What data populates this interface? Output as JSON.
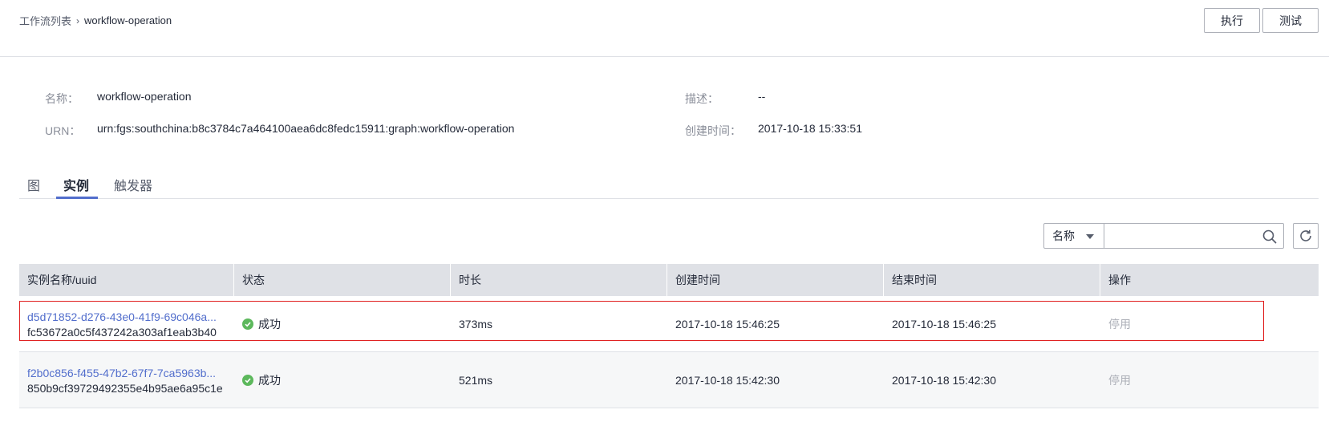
{
  "breadcrumb": {
    "parent": "工作流列表",
    "separator": "›",
    "current": "workflow-operation"
  },
  "toolbar": {
    "execute_label": "执行",
    "test_label": "测试"
  },
  "info": {
    "name_label": "名称：",
    "name_value": "workflow-operation",
    "urn_label": "URN：",
    "urn_value": "urn:fgs:southchina:b8c3784c7a464100aea6dc8fedc15911:graph:workflow-operation",
    "desc_label": "描述：",
    "desc_value": "--",
    "created_label": "创建时间：",
    "created_value": "2017-10-18 15:33:51"
  },
  "tabs": [
    {
      "label": "图",
      "active": false
    },
    {
      "label": "实例",
      "active": true
    },
    {
      "label": "触发器",
      "active": false
    }
  ],
  "search": {
    "select_value": "名称",
    "placeholder": ""
  },
  "icons": {
    "search": "search-icon",
    "refresh": "refresh-icon",
    "status": "check-circle-icon",
    "caret": "caret-down-icon"
  },
  "colors": {
    "accent": "#526ecc",
    "success": "#5cb85c",
    "highlight": "#e02020",
    "header_bg": "#dfe1e6"
  },
  "table": {
    "headers": [
      "实例名称/uuid",
      "状态",
      "时长",
      "创建时间",
      "结束时间",
      "操作"
    ],
    "rows": [
      {
        "name": "d5d71852-d276-43e0-41f9-69c046a...",
        "uuid": "fc53672a0c5f437242a303af1eab3b40",
        "status": "成功",
        "duration": "373ms",
        "created": "2017-10-18 15:46:25",
        "ended": "2017-10-18 15:46:25",
        "action": "停用"
      },
      {
        "name": "f2b0c856-f455-47b2-67f7-7ca5963b...",
        "uuid": "850b9cf39729492355e4b95ae6a95c1e",
        "status": "成功",
        "duration": "521ms",
        "created": "2017-10-18 15:42:30",
        "ended": "2017-10-18 15:42:30",
        "action": "停用"
      }
    ]
  }
}
